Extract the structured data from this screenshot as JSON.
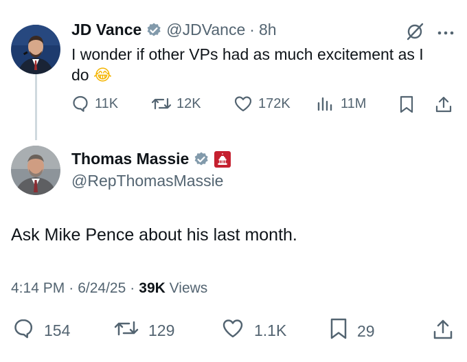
{
  "colors": {
    "text": "#0f1419",
    "secondary": "#536471",
    "verified": "#829aab",
    "thread_line": "#cfd9de",
    "gov_badge": "#c5202f"
  },
  "quoted_post": {
    "author_name": "JD Vance",
    "author_handle": "@JDVance",
    "separator": "·",
    "time": "8h",
    "text_line1": "I wonder if other VPs had as much excitement as I",
    "text_line2": "do",
    "emoji": "😂",
    "icons": [
      "verified-badge-icon",
      "grok-icon",
      "more-icon"
    ],
    "actions": {
      "replies": "11K",
      "reposts": "12K",
      "likes": "172K",
      "views": "11M"
    }
  },
  "main_post": {
    "author_name": "Thomas Massie",
    "author_handle": "@RepThomasMassie",
    "text": "Ask Mike Pence about his last month.",
    "time": "4:14 PM",
    "date": "6/24/25",
    "separator": "·",
    "views_count": "39K",
    "views_label": "Views",
    "icons": [
      "verified-badge-icon",
      "us-capitol-badge-icon"
    ],
    "actions": {
      "replies": "154",
      "reposts": "129",
      "likes": "1.1K",
      "bookmarks": "29"
    }
  }
}
